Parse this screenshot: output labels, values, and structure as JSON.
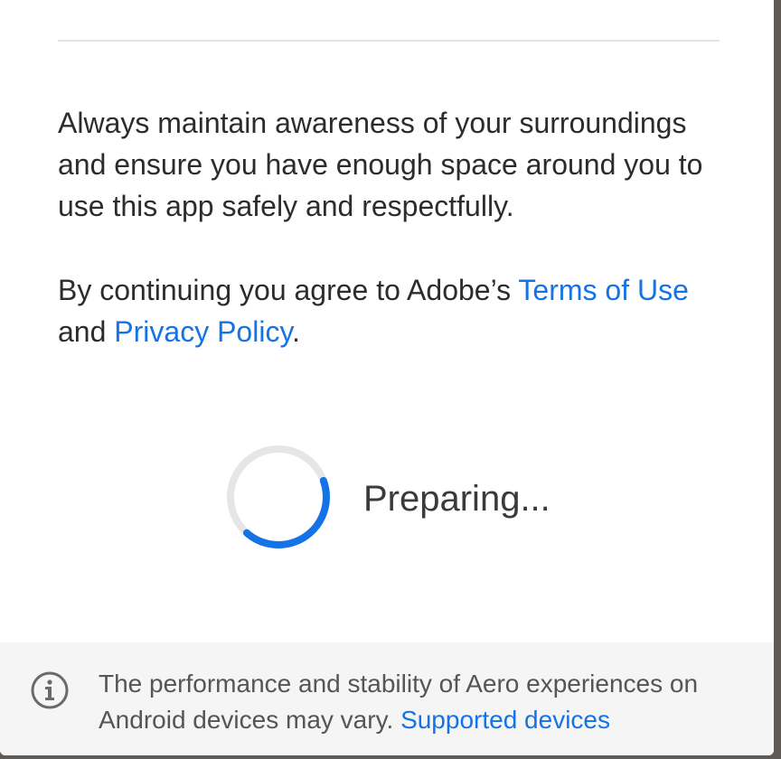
{
  "dialog": {
    "awareness_text": "Always maintain awareness of your surroundings and ensure you have enough space around you to use this app safely and respectfully.",
    "agree_prefix": "By continuing you agree to Adobe’s ",
    "terms_link": "Terms of Use",
    "agree_middle": " and ",
    "privacy_link": "Privacy Policy",
    "agree_suffix": ".",
    "status_text": "Preparing...",
    "loading_progress": 0.42
  },
  "footer": {
    "icon": "info-icon",
    "notice_text": "The performance and stability of Aero experiences on Android devices may vary. ",
    "supported_link": "Supported devices"
  },
  "colors": {
    "link": "#1473e6",
    "spinner_active": "#1473e6",
    "spinner_track": "#e6e6e6",
    "footer_bg": "#f5f5f5"
  }
}
